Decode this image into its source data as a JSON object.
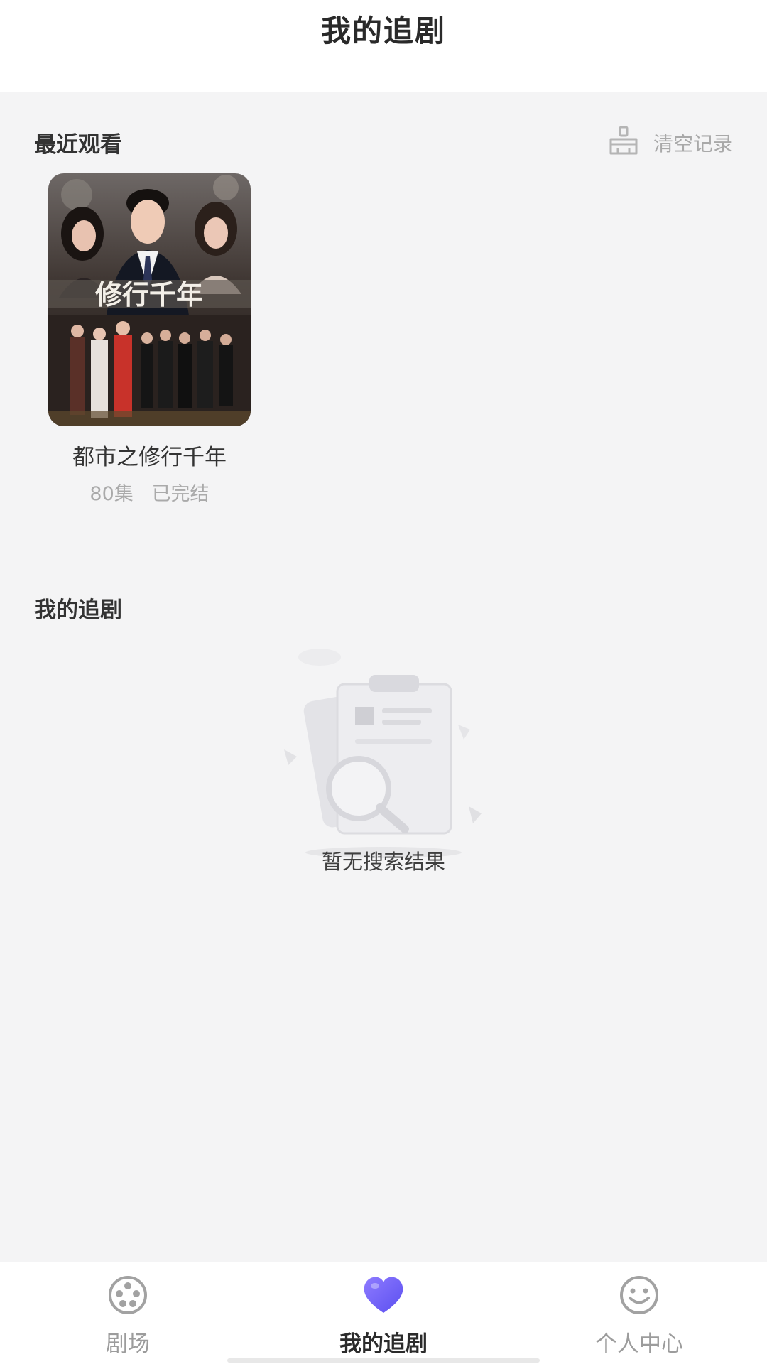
{
  "header": {
    "title": "我的追剧"
  },
  "recent": {
    "section_title": "最近观看",
    "clear_label": "清空记录",
    "items": [
      {
        "title": "都市之修行千年",
        "poster_text": "修行千年",
        "episodes": "80集",
        "status": "已完结"
      }
    ]
  },
  "following": {
    "section_title": "我的追剧",
    "empty_text": "暂无搜索结果"
  },
  "tabbar": {
    "tabs": [
      {
        "label": "剧场",
        "icon": "film-reel-icon",
        "active": false
      },
      {
        "label": "我的追剧",
        "icon": "heart-icon",
        "active": true
      },
      {
        "label": "个人中心",
        "icon": "smiley-icon",
        "active": false
      }
    ]
  },
  "colors": {
    "accent": "#6a5cf6",
    "accent2": "#8e7bff",
    "background": "#f4f4f5"
  }
}
